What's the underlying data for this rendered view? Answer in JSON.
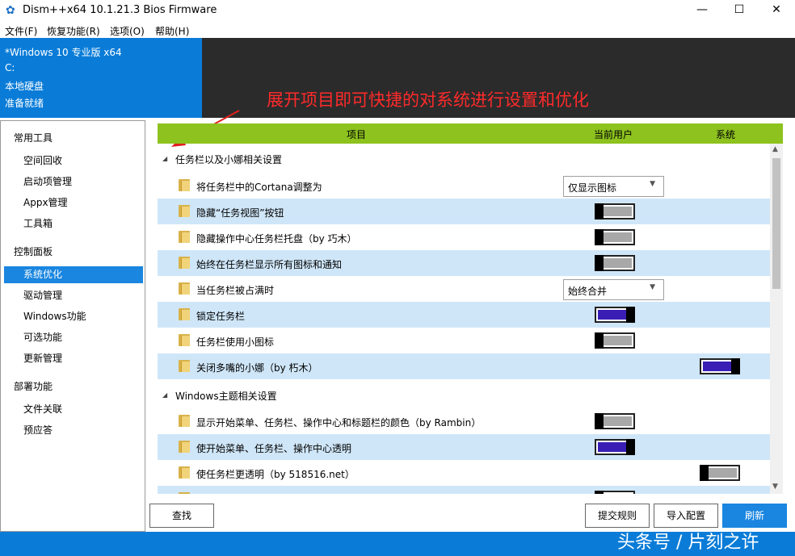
{
  "window": {
    "title": "Dism++x64 10.1.21.3 Bios Firmware",
    "minimize": "—",
    "maximize": "☐",
    "close": "✕"
  },
  "menu": [
    "文件(F)",
    "恢复功能(R)",
    "选项(O)",
    "帮助(H)"
  ],
  "info": {
    "os": "*Windows 10 专业版 x64",
    "drive": "C:",
    "disk": "本地硬盘",
    "status": "准备就绪"
  },
  "banner": {
    "text": "展开项目即可快捷的对系统进行设置和优化"
  },
  "nav": {
    "groups": [
      {
        "label": "常用工具",
        "items": [
          "空间回收",
          "启动项管理",
          "Appx管理",
          "工具箱"
        ]
      },
      {
        "label": "控制面板",
        "items": [
          "系统优化",
          "驱动管理",
          "Windows功能",
          "可选功能",
          "更新管理"
        ]
      },
      {
        "label": "部署功能",
        "items": [
          "文件关联",
          "预应答"
        ]
      }
    ],
    "active": "系统优化"
  },
  "table": {
    "headers": {
      "item": "项目",
      "user": "当前用户",
      "system": "系统"
    },
    "sections": [
      {
        "label": "任务栏以及小娜相关设置",
        "rows": [
          {
            "label": "将任务栏中的Cortana调整为",
            "control": "dropdown",
            "value": "仅显示图标"
          },
          {
            "label": "隐藏“任务视图”按钮",
            "control": "toggle",
            "col": "user",
            "on": false
          },
          {
            "label": "隐藏操作中心任务栏托盘（by 巧木）",
            "control": "toggle",
            "col": "user",
            "on": false
          },
          {
            "label": "始终在任务栏显示所有图标和通知",
            "control": "toggle",
            "col": "user",
            "on": false
          },
          {
            "label": "当任务栏被占满时",
            "control": "dropdown",
            "value": "始终合并"
          },
          {
            "label": "锁定任务栏",
            "control": "toggle",
            "col": "user",
            "on": true
          },
          {
            "label": "任务栏使用小图标",
            "control": "toggle",
            "col": "user",
            "on": false
          },
          {
            "label": "关闭多嘴的小娜（by 朽木）",
            "control": "toggle",
            "col": "system",
            "on": true
          }
        ]
      },
      {
        "label": "Windows主题相关设置",
        "rows": [
          {
            "label": "显示开始菜单、任务栏、操作中心和标题栏的颜色（by Rambin）",
            "control": "toggle",
            "col": "user",
            "on": false
          },
          {
            "label": "使开始菜单、任务栏、操作中心透明",
            "control": "toggle",
            "col": "user",
            "on": true
          },
          {
            "label": "使任务栏更透明（by 518516.net）",
            "control": "toggle",
            "col": "system",
            "on": false
          }
        ]
      }
    ]
  },
  "buttons": {
    "find": "查找",
    "submit": "提交规则",
    "import": "导入配置",
    "refresh": "刷新"
  },
  "watermark": "头条号 / 片刻之许",
  "colors": {
    "accent": "#0a7cd8",
    "header": "#8dc21f",
    "row_alt": "#cfe6f8",
    "toggle_on": "#3a1db5",
    "banner_text": "#ff2a2a"
  }
}
